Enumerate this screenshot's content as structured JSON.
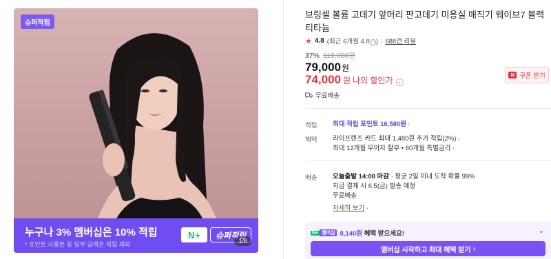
{
  "image": {
    "super_badge": "슈퍼적립",
    "banner_main": "누구나 3% 멤버십은 10% 적립",
    "banner_sub": "* 포인트 사용분 등 일부 금액은 적립 제외",
    "banner_logo_n": "N",
    "banner_logo_plus": "+",
    "banner_logo_super": "슈퍼적립",
    "page_counter": "1/6"
  },
  "product": {
    "title": "브링셀 볼륨 고데기 앞머리 판고데기 미용실 매직기 웨이브7 블랙 티타늄",
    "rating_score": "4.8",
    "rating_recent": "(최근 6개월 4.8",
    "rating_recent_close": ")",
    "review_count": "688건 리뷰",
    "discount_rate": "37%",
    "original_price": "119,000원",
    "sale_price": "79,000",
    "sale_price_unit": "원",
    "my_price": "74,000",
    "my_price_unit": "원",
    "my_price_label": "나의 할인가",
    "coupon_label": "쿠폰 받기",
    "coupon_icon_text": "N",
    "free_shipping": "무료배송"
  },
  "details": {
    "points_label": "적립",
    "points_prefix": "최대 적립 포인트 ",
    "points_value": "16,580원",
    "benefit_label": "혜택",
    "benefit_line1": "라이프렌즈 카드 최대 1,480원 추가 적립(2%)",
    "benefit_line2": "최대 12개월 무이자 할부 • 60개월 특별금리",
    "delivery_label": "배송",
    "delivery_today": "오늘출발 14:00 마감",
    "delivery_today_rest": " · 평균 2일 이내 도착 확률 99%",
    "delivery_line2": "지금 결제 시 6.5(금) 발송 예정",
    "delivery_line3": "무료배송",
    "more_link": "자세히 보기"
  },
  "membership": {
    "badge_n": "N+",
    "badge_text": "멤버십",
    "amount": "8,140원",
    "text": " 혜택 받으세요!",
    "button_label": "멤버십 시작하고 최대 혜택 받기"
  },
  "colors": {
    "accent_purple": "#7a52f4",
    "sale_red": "#e8323c",
    "naver_green": "#03c75a"
  }
}
